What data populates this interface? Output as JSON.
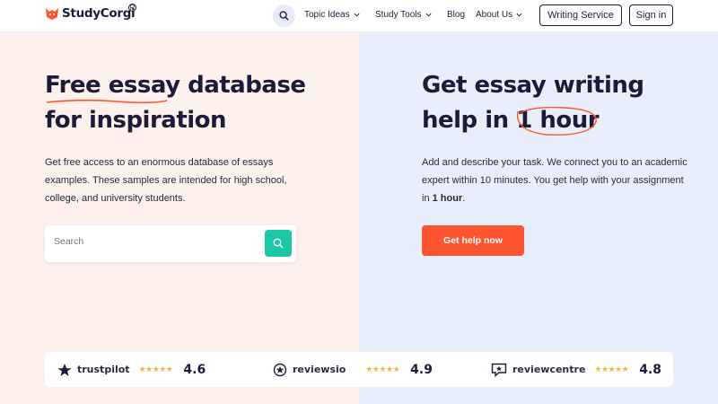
{
  "header": {
    "logo_text": "StudyCorgi",
    "logo_reg": "R",
    "nav": [
      "Topic Ideas",
      "Study Tools",
      "Blog",
      "About Us"
    ],
    "writing_service": "Writing Service",
    "sign_in": "Sign in"
  },
  "left": {
    "title_word1": "Free essay",
    "title_rest": " database",
    "title_line2": "for inspiration",
    "description": "Get free access to an enormous database of essays examples. These samples are intended for high school, college, and university students.",
    "search_placeholder": "Search"
  },
  "right": {
    "title_line1": "Get essay writing",
    "title_line2_prefix": "help in ",
    "title_highlight": "1 hour",
    "description_before": "Add and describe your task. We connect you to an academic expert within 10 minutes. You get help with your assignment in ",
    "description_bold": "1 hour",
    "description_after": ".",
    "cta": "Get help now"
  },
  "ratings": [
    {
      "name": "trustpilot",
      "score": "4.6",
      "stars": 5,
      "icon": "trustpilot-star-icon"
    },
    {
      "name": "reviewsio",
      "score": "4.9",
      "stars": 5,
      "icon": "reviewsio-icon"
    },
    {
      "name": "reviewcentre",
      "score": "4.8",
      "stars": 5,
      "icon": "reviewcentre-icon"
    }
  ],
  "colors": {
    "accent_orange": "#ff5431",
    "teal": "#1bc8a6",
    "left_bg": "#fdf0ed",
    "right_bg": "#e9effa",
    "star": "#f5b33c"
  }
}
